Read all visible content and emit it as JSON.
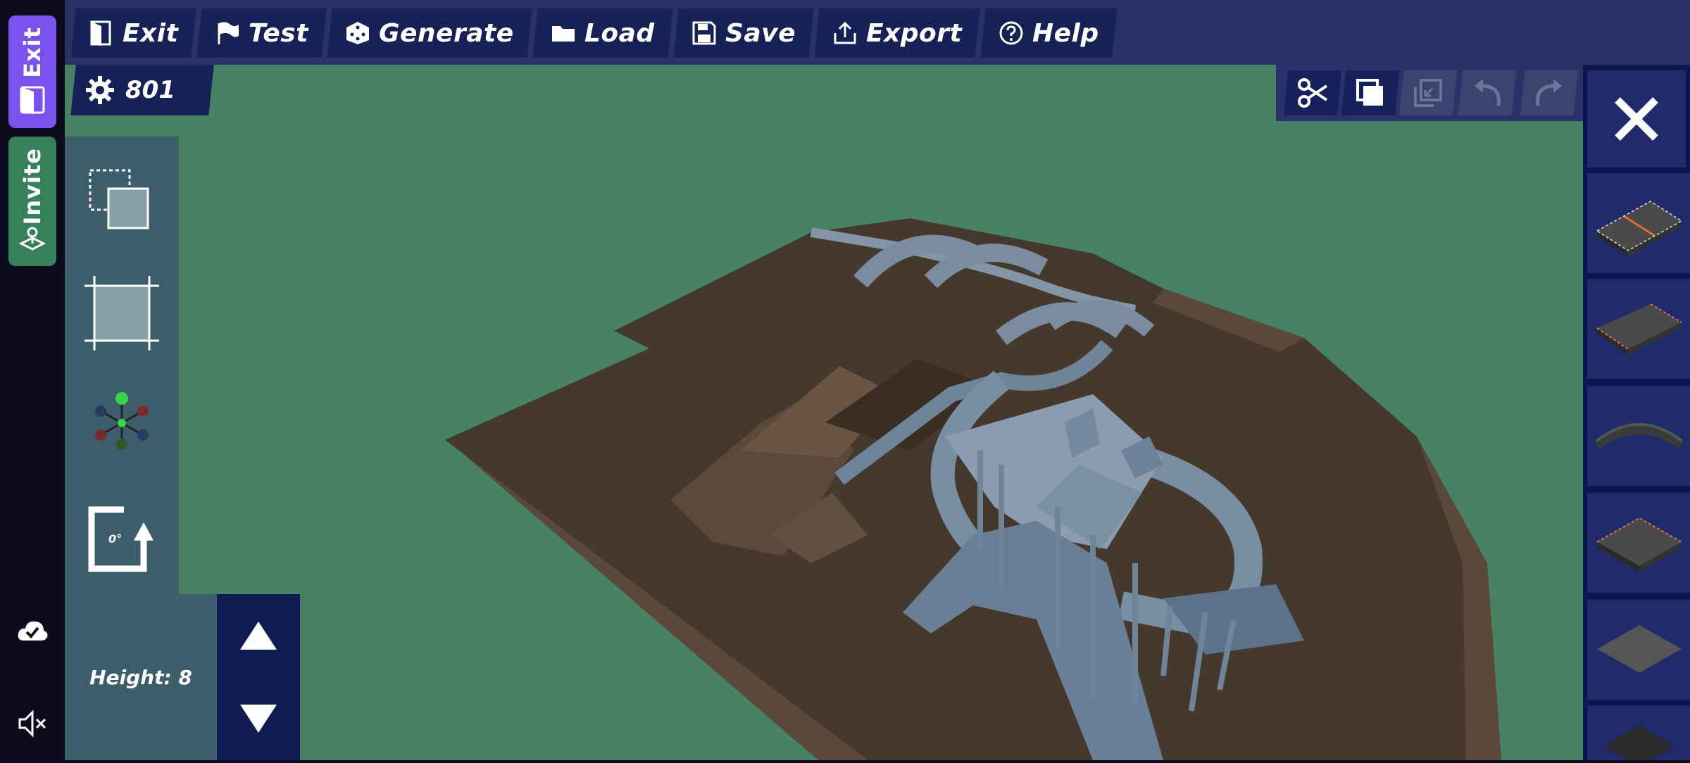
{
  "side": {
    "exit_label": "Exit",
    "invite_label": "Invite"
  },
  "menu": [
    {
      "label": "Exit",
      "icon": "door-exit-icon"
    },
    {
      "label": "Test",
      "icon": "flag-icon"
    },
    {
      "label": "Generate",
      "icon": "dice-icon"
    },
    {
      "label": "Load",
      "icon": "folder-icon"
    },
    {
      "label": "Save",
      "icon": "floppy-disk-icon"
    },
    {
      "label": "Export",
      "icon": "export-icon"
    },
    {
      "label": "Help",
      "icon": "help-circle-icon"
    }
  ],
  "counter": {
    "value": "801",
    "icon": "gear-icon"
  },
  "height": {
    "label": "Height: 8"
  },
  "rotation": {
    "label": "0°"
  },
  "colors": {
    "accent_exit": "#7a52f0",
    "accent_invite": "#36805a",
    "grass": "#478265",
    "dirt": "#46382c",
    "track": "#6f8499",
    "panel": "#162155"
  }
}
